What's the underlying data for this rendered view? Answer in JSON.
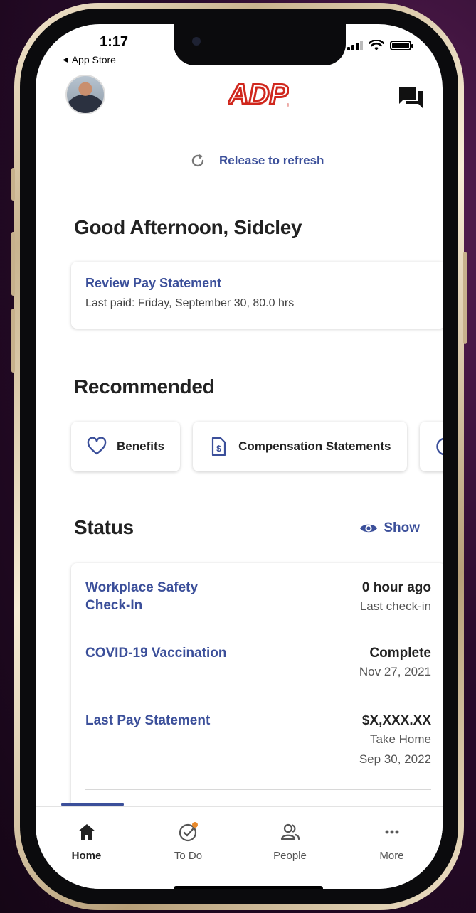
{
  "status_bar": {
    "time": "1:17",
    "back_label": "App Store"
  },
  "header": {
    "logo_text": "ADP",
    "avatar_alt": "Profile photo"
  },
  "refresh": {
    "label": "Release to refresh"
  },
  "greeting": "Good Afternoon, Sidcley",
  "pay_card": {
    "title": "Review Pay Statement",
    "subtitle": "Last paid: Friday, September 30, 80.0 hrs"
  },
  "recommended": {
    "title": "Recommended",
    "items": [
      {
        "label": "Benefits",
        "icon": "heart-icon"
      },
      {
        "label": "Compensation Statements",
        "icon": "document-dollar-icon"
      },
      {
        "label": "",
        "icon": "dollar-circle-icon"
      }
    ]
  },
  "status": {
    "title": "Status",
    "show_label": "Show",
    "rows": [
      {
        "label": "Workplace Safety Check-In",
        "value": "0 hour ago",
        "sub": [
          "Last check-in"
        ]
      },
      {
        "label": "COVID-19 Vaccination",
        "value": "Complete",
        "sub": [
          "Nov 27, 2021"
        ]
      },
      {
        "label": "Last Pay Statement",
        "value": "$X,XXX.XX",
        "sub": [
          "Take Home",
          "Sep 30, 2022"
        ]
      }
    ]
  },
  "tabs": [
    {
      "label": "Home",
      "icon": "home-icon",
      "active": true
    },
    {
      "label": "To Do",
      "icon": "check-circle-icon",
      "active": false
    },
    {
      "label": "People",
      "icon": "people-icon",
      "active": false
    },
    {
      "label": "More",
      "icon": "more-dots-icon",
      "active": false
    }
  ],
  "colors": {
    "accent": "#3b4f9a",
    "brand_red": "#d0271d",
    "notification_dot": "#e8892b"
  }
}
